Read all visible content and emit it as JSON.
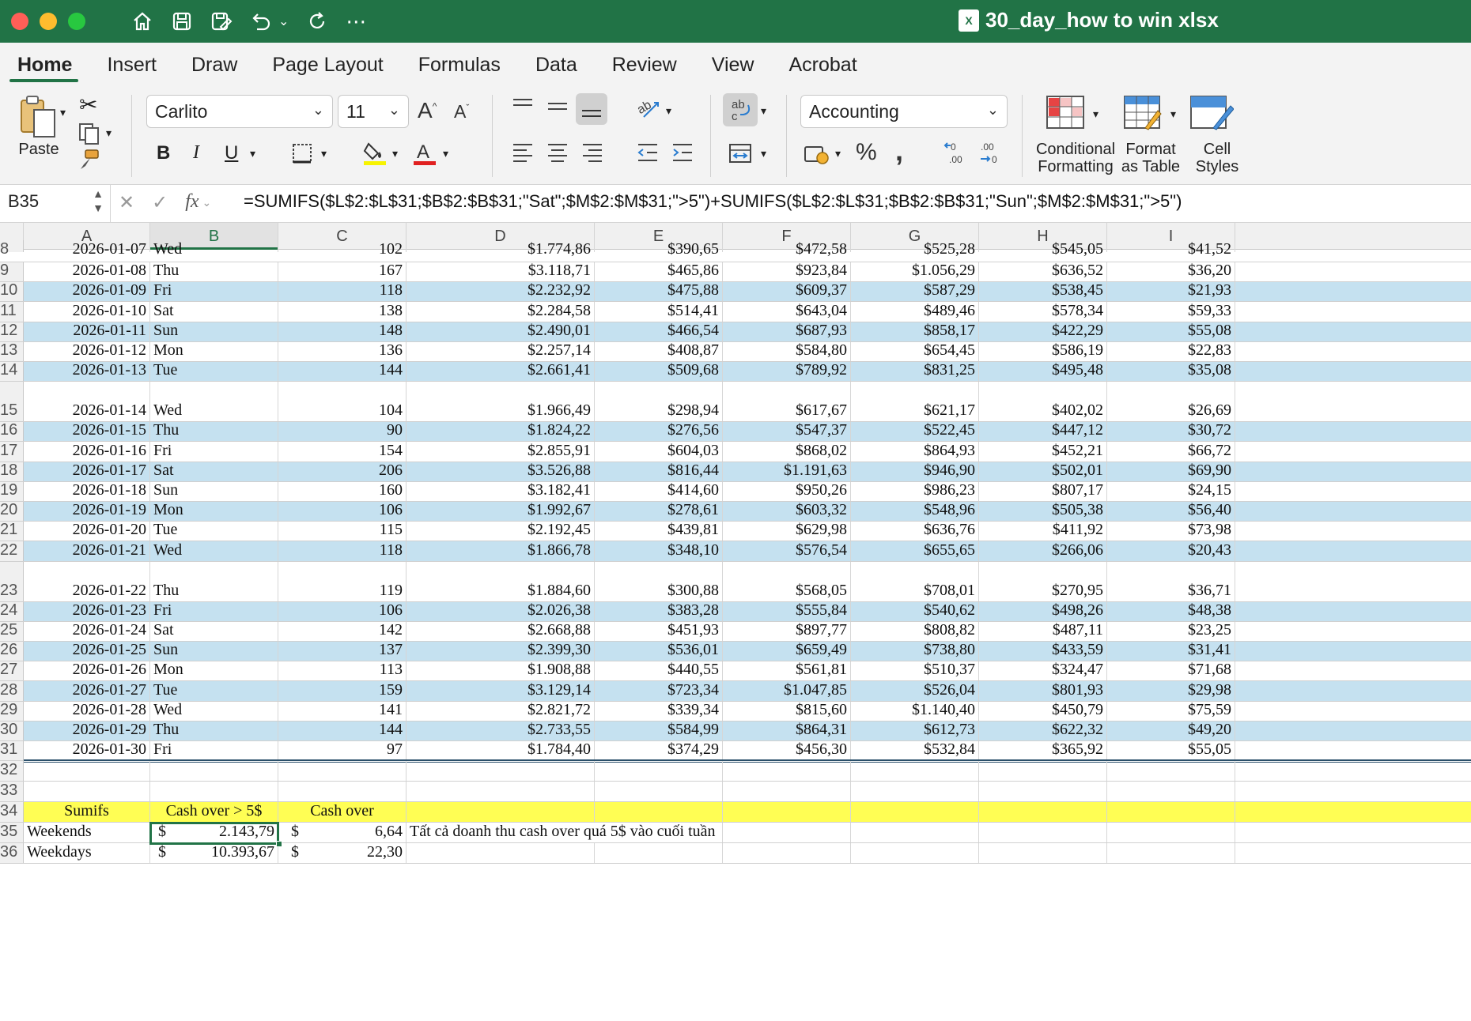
{
  "window": {
    "title": "30_day_how to win xlsx",
    "traffic_colors": [
      "#ff5f57",
      "#febc2e",
      "#28c840"
    ]
  },
  "tabs": [
    "Home",
    "Insert",
    "Draw",
    "Page Layout",
    "Formulas",
    "Data",
    "Review",
    "View",
    "Acrobat"
  ],
  "ribbon": {
    "paste_label": "Paste",
    "font_name": "Carlito",
    "font_size": "11",
    "number_format": "Accounting",
    "conditional_formatting": [
      "Conditional",
      "Formatting"
    ],
    "format_as_table": [
      "Format",
      "as Table"
    ],
    "cell_styles": [
      "Cell",
      "Styles"
    ],
    "bold": "B",
    "italic": "I",
    "underline": "U",
    "percent": "%",
    "comma": ","
  },
  "formula_bar": {
    "name_box": "B35",
    "fx": "fx",
    "formula": "=SUMIFS($L$2:$L$31;$B$2:$B$31;\"Sat\";$M$2:$M$31;\">5\")+SUMIFS($L$2:$L$31;$B$2:$B$31;\"Sun\";$M$2:$M$31;\">5\")"
  },
  "columns": [
    "A",
    "B",
    "C",
    "D",
    "E",
    "F",
    "G",
    "H",
    "I"
  ],
  "selected_column": "B",
  "rows": [
    {
      "n": "8",
      "cells": [
        "2026-01-07",
        "Wed",
        "102",
        "$1.774,86",
        "$390,65",
        "$472,58",
        "$525,28",
        "$545,05",
        "$41,52"
      ],
      "blue": false,
      "partial": true
    },
    {
      "n": "9",
      "cells": [
        "2026-01-08",
        "Thu",
        "167",
        "$3.118,71",
        "$465,86",
        "$923,84",
        "$1.056,29",
        "$636,52",
        "$36,20"
      ],
      "blue": false
    },
    {
      "n": "10",
      "cells": [
        "2026-01-09",
        "Fri",
        "118",
        "$2.232,92",
        "$475,88",
        "$609,37",
        "$587,29",
        "$538,45",
        "$21,93"
      ],
      "blue": true
    },
    {
      "n": "11",
      "cells": [
        "2026-01-10",
        "Sat",
        "138",
        "$2.284,58",
        "$514,41",
        "$643,04",
        "$489,46",
        "$578,34",
        "$59,33"
      ],
      "blue": false
    },
    {
      "n": "12",
      "cells": [
        "2026-01-11",
        "Sun",
        "148",
        "$2.490,01",
        "$466,54",
        "$687,93",
        "$858,17",
        "$422,29",
        "$55,08"
      ],
      "blue": true
    },
    {
      "n": "13",
      "cells": [
        "2026-01-12",
        "Mon",
        "136",
        "$2.257,14",
        "$408,87",
        "$584,80",
        "$654,45",
        "$586,19",
        "$22,83"
      ],
      "blue": false
    },
    {
      "n": "14",
      "cells": [
        "2026-01-13",
        "Tue",
        "144",
        "$2.661,41",
        "$509,68",
        "$789,92",
        "$831,25",
        "$495,48",
        "$35,08"
      ],
      "blue": true
    },
    {
      "n": "15",
      "cells": [
        "2026-01-14",
        "Wed",
        "104",
        "$1.966,49",
        "$298,94",
        "$617,67",
        "$621,17",
        "$402,02",
        "$26,69"
      ],
      "blue": false,
      "tall": true
    },
    {
      "n": "16",
      "cells": [
        "2026-01-15",
        "Thu",
        "90",
        "$1.824,22",
        "$276,56",
        "$547,37",
        "$522,45",
        "$447,12",
        "$30,72"
      ],
      "blue": true
    },
    {
      "n": "17",
      "cells": [
        "2026-01-16",
        "Fri",
        "154",
        "$2.855,91",
        "$604,03",
        "$868,02",
        "$864,93",
        "$452,21",
        "$66,72"
      ],
      "blue": false
    },
    {
      "n": "18",
      "cells": [
        "2026-01-17",
        "Sat",
        "206",
        "$3.526,88",
        "$816,44",
        "$1.191,63",
        "$946,90",
        "$502,01",
        "$69,90"
      ],
      "blue": true
    },
    {
      "n": "19",
      "cells": [
        "2026-01-18",
        "Sun",
        "160",
        "$3.182,41",
        "$414,60",
        "$950,26",
        "$986,23",
        "$807,17",
        "$24,15"
      ],
      "blue": false
    },
    {
      "n": "20",
      "cells": [
        "2026-01-19",
        "Mon",
        "106",
        "$1.992,67",
        "$278,61",
        "$603,32",
        "$548,96",
        "$505,38",
        "$56,40"
      ],
      "blue": true
    },
    {
      "n": "21",
      "cells": [
        "2026-01-20",
        "Tue",
        "115",
        "$2.192,45",
        "$439,81",
        "$629,98",
        "$636,76",
        "$411,92",
        "$73,98"
      ],
      "blue": false
    },
    {
      "n": "22",
      "cells": [
        "2026-01-21",
        "Wed",
        "118",
        "$1.866,78",
        "$348,10",
        "$576,54",
        "$655,65",
        "$266,06",
        "$20,43"
      ],
      "blue": true
    },
    {
      "n": "23",
      "cells": [
        "2026-01-22",
        "Thu",
        "119",
        "$1.884,60",
        "$300,88",
        "$568,05",
        "$708,01",
        "$270,95",
        "$36,71"
      ],
      "blue": false,
      "tall": true
    },
    {
      "n": "24",
      "cells": [
        "2026-01-23",
        "Fri",
        "106",
        "$2.026,38",
        "$383,28",
        "$555,84",
        "$540,62",
        "$498,26",
        "$48,38"
      ],
      "blue": true
    },
    {
      "n": "25",
      "cells": [
        "2026-01-24",
        "Sat",
        "142",
        "$2.668,88",
        "$451,93",
        "$897,77",
        "$808,82",
        "$487,11",
        "$23,25"
      ],
      "blue": false
    },
    {
      "n": "26",
      "cells": [
        "2026-01-25",
        "Sun",
        "137",
        "$2.399,30",
        "$536,01",
        "$659,49",
        "$738,80",
        "$433,59",
        "$31,41"
      ],
      "blue": true
    },
    {
      "n": "27",
      "cells": [
        "2026-01-26",
        "Mon",
        "113",
        "$1.908,88",
        "$440,55",
        "$561,81",
        "$510,37",
        "$324,47",
        "$71,68"
      ],
      "blue": false
    },
    {
      "n": "28",
      "cells": [
        "2026-01-27",
        "Tue",
        "159",
        "$3.129,14",
        "$723,34",
        "$1.047,85",
        "$526,04",
        "$801,93",
        "$29,98"
      ],
      "blue": true
    },
    {
      "n": "29",
      "cells": [
        "2026-01-28",
        "Wed",
        "141",
        "$2.821,72",
        "$339,34",
        "$815,60",
        "$1.140,40",
        "$450,79",
        "$75,59"
      ],
      "blue": false
    },
    {
      "n": "30",
      "cells": [
        "2026-01-29",
        "Thu",
        "144",
        "$2.733,55",
        "$584,99",
        "$864,31",
        "$612,73",
        "$622,32",
        "$49,20"
      ],
      "blue": true
    },
    {
      "n": "31",
      "cells": [
        "2026-01-30",
        "Fri",
        "97",
        "$1.784,40",
        "$374,29",
        "$456,30",
        "$532,84",
        "$365,92",
        "$55,05"
      ],
      "blue": false
    }
  ],
  "summary": {
    "row32": "32",
    "row33": "33",
    "row34": {
      "n": "34",
      "a": "Sumifs",
      "b": "Cash over > 5$",
      "c": "Cash over"
    },
    "row35": {
      "n": "35",
      "a": "Weekends",
      "b_cur": "$",
      "b_val": "2.143,79",
      "c_cur": "$",
      "c_val": "6,64",
      "note": "Tất cả doanh thu cash over quá 5$ vào cuối tuần"
    },
    "row36": {
      "n": "36",
      "a": "Weekdays",
      "b_cur": "$",
      "b_val": "10.393,67",
      "c_cur": "$",
      "c_val": "22,30"
    }
  }
}
